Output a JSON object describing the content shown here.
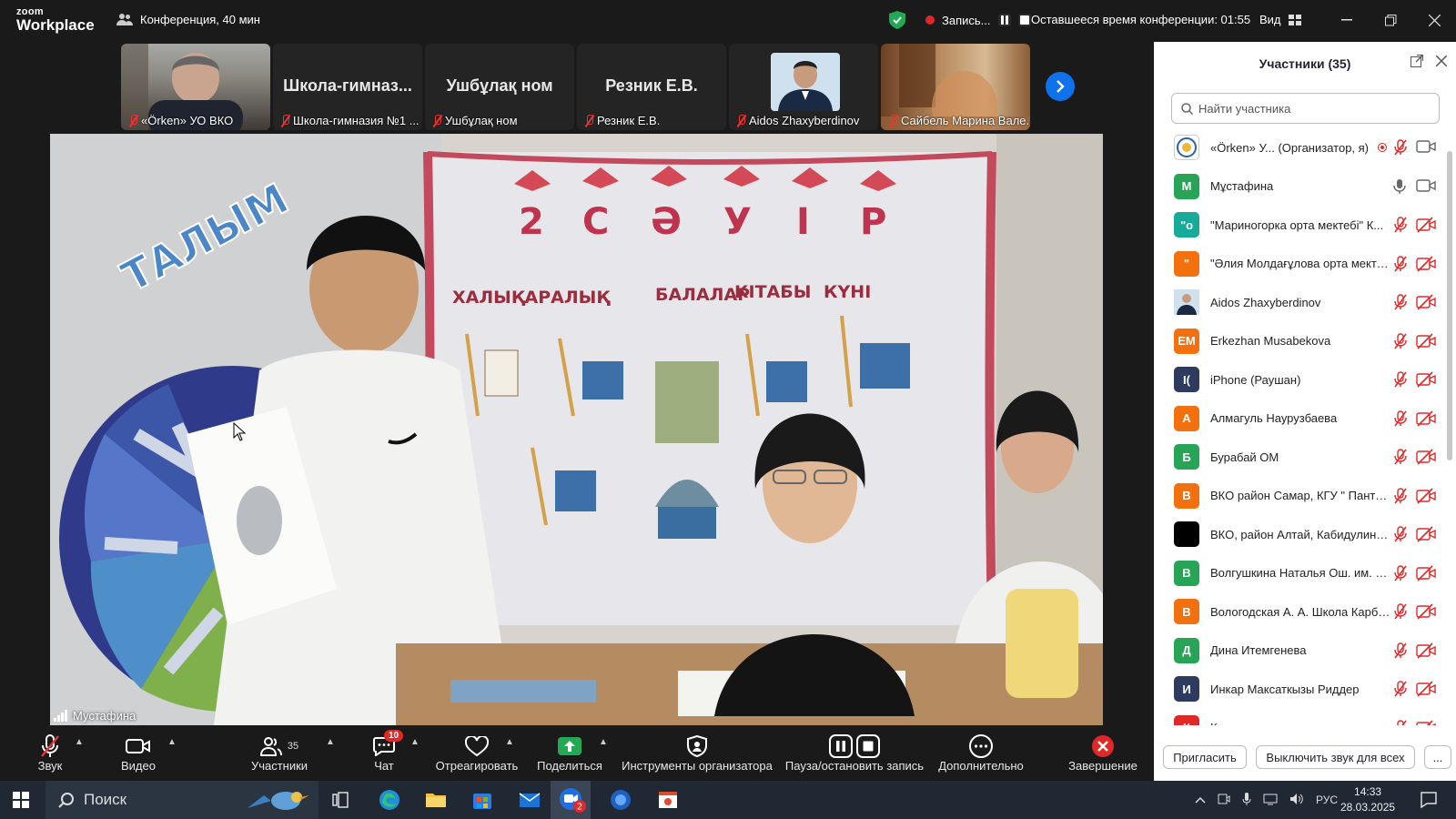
{
  "titlebar": {
    "logo_top": "zoom",
    "logo_bottom": "Workplace",
    "meeting": "Конференция, 40 мин",
    "recording": "Запись...",
    "time_left": "Оставшееся время конференции: 01:55",
    "view": "Вид"
  },
  "thumbnails": [
    {
      "name": "«Örken» УО ВКО",
      "big": ""
    },
    {
      "name": "Школа-гимназия №1 ...",
      "big": "Школа-гимназ..."
    },
    {
      "name": "Ушбұлақ ном",
      "big": "Ушбұлақ ном"
    },
    {
      "name": "Резник Е.В.",
      "big": "Резник Е.В."
    },
    {
      "name": "Aidos Zhaxyberdinov",
      "big": ""
    },
    {
      "name": "Сайбель Марина Вале...",
      "big": ""
    }
  ],
  "video": {
    "speaker": "Мустафина",
    "banner_letters": "2 С Ә У І Р",
    "banner_text": "ХАЛЫҚАРАЛЫҚ БАЛАЛАР КІТАБЫ КҮНІ"
  },
  "panel": {
    "title": "Участники (35)",
    "search_placeholder": "Найти участника",
    "invite": "Пригласить",
    "mute_all": "Выключить звук для всех",
    "more": "...",
    "participants": [
      {
        "initials": "",
        "color": "#ffffff",
        "name": "«Örken» У... (Организатор, я)",
        "mic": "muted",
        "cam": "on"
      },
      {
        "initials": "М",
        "color": "#27a456",
        "name": "Мұстафина",
        "mic": "on",
        "cam": "on"
      },
      {
        "initials": "\"о",
        "color": "#17a99a",
        "name": "\"Мариногорка орта мектебі\" К...",
        "mic": "muted",
        "cam": "off"
      },
      {
        "initials": "\"",
        "color": "#f2700e",
        "name": "\"Әлия Молдағұлова орта мекте...",
        "mic": "muted",
        "cam": "off"
      },
      {
        "initials": "",
        "color": "#5a6e8a",
        "name": "Aidos Zhaxyberdinov",
        "mic": "muted",
        "cam": "off"
      },
      {
        "initials": "EM",
        "color": "#f2700e",
        "name": "Erkezhan Musabekova",
        "mic": "muted",
        "cam": "off"
      },
      {
        "initials": "I(",
        "color": "#2d3b5e",
        "name": "iPhone (Раушан)",
        "mic": "muted",
        "cam": "off"
      },
      {
        "initials": "А",
        "color": "#f2700e",
        "name": "Алмагуль Наурузбаева",
        "mic": "muted",
        "cam": "off"
      },
      {
        "initials": "Б",
        "color": "#27a456",
        "name": "Бурабай ОМ",
        "mic": "muted",
        "cam": "off"
      },
      {
        "initials": "В",
        "color": "#f2700e",
        "name": "ВКО район Самар, КГУ \" Пантел...",
        "mic": "muted",
        "cam": "off"
      },
      {
        "initials": "",
        "color": "#000000",
        "name": "ВКО, район Алтай, Кабидулино...",
        "mic": "muted",
        "cam": "off"
      },
      {
        "initials": "В",
        "color": "#27a456",
        "name": "Волгушкина Наталья Ош. им. С...",
        "mic": "muted",
        "cam": "off"
      },
      {
        "initials": "В",
        "color": "#f2700e",
        "name": "Вологодская А. А. Школа Карбы...",
        "mic": "muted",
        "cam": "off"
      },
      {
        "initials": "Д",
        "color": "#27a456",
        "name": "Дина Итемгенева",
        "mic": "muted",
        "cam": "off"
      },
      {
        "initials": "И",
        "color": "#2d3b5e",
        "name": "Инкар Максаткызы Риддер",
        "mic": "muted",
        "cam": "off"
      },
      {
        "initials": "К",
        "color": "#e02828",
        "name": "Каракольская о.ш",
        "mic": "muted",
        "cam": "off"
      }
    ]
  },
  "toolbar": {
    "audio": "Звук",
    "video": "Видео",
    "participants": "Участники",
    "participants_count": "35",
    "chat": "Чат",
    "chat_badge": "10",
    "react": "Отреагировать",
    "share": "Поделиться",
    "host_tools": "Инструменты организатора",
    "pause_rec": "Пауза/остановить запись",
    "more": "Дополнительно",
    "end": "Завершение"
  },
  "taskbar": {
    "search": "Поиск",
    "lang": "РУС",
    "time": "14:33",
    "date": "28.03.2025",
    "mail_badge": "2"
  }
}
